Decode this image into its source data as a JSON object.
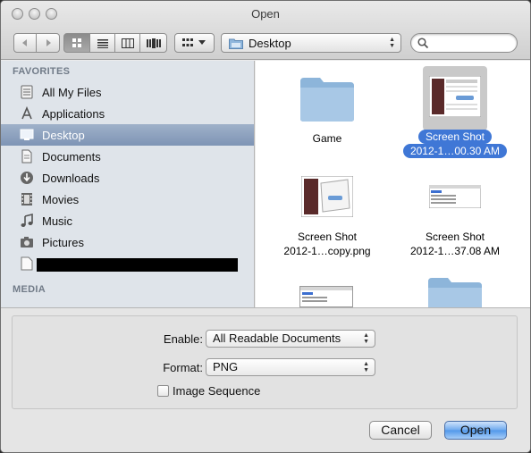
{
  "window": {
    "title": "Open"
  },
  "toolbar": {
    "back_icon": "chevron-left-icon",
    "forward_icon": "chevron-right-icon",
    "view_modes": [
      "icon-view",
      "list-view",
      "column-view",
      "coverflow-view"
    ],
    "arrange_icon": "grid-icon",
    "location": "Desktop",
    "search_placeholder": ""
  },
  "sidebar": {
    "favorites_header": "FAVORITES",
    "items": [
      {
        "label": "All My Files",
        "icon": "all-files-icon"
      },
      {
        "label": "Applications",
        "icon": "applications-icon"
      },
      {
        "label": "Desktop",
        "icon": "desktop-icon",
        "selected": true
      },
      {
        "label": "Documents",
        "icon": "documents-icon"
      },
      {
        "label": "Downloads",
        "icon": "downloads-icon"
      },
      {
        "label": "Movies",
        "icon": "movies-icon"
      },
      {
        "label": "Music",
        "icon": "music-icon"
      },
      {
        "label": "Pictures",
        "icon": "pictures-icon"
      }
    ],
    "media_header": "MEDIA"
  },
  "files": [
    {
      "line1": "Game",
      "line2": "",
      "kind": "folder"
    },
    {
      "line1": "Screen Shot",
      "line2": "2012-1…00.30 AM",
      "kind": "screenshot",
      "selected": true
    },
    {
      "line1": "Screen Shot",
      "line2": "2012-1…copy.png",
      "kind": "screenshot"
    },
    {
      "line1": "Screen Shot",
      "line2": "2012-1…37.08 AM",
      "kind": "screenshot"
    }
  ],
  "options": {
    "enable_label": "Enable:",
    "enable_value": "All Readable Documents",
    "format_label": "Format:",
    "format_value": "PNG",
    "image_sequence_label": "Image Sequence",
    "image_sequence_checked": false
  },
  "buttons": {
    "cancel": "Cancel",
    "open": "Open"
  },
  "colors": {
    "selection": "#3f77d6",
    "sidebar_bg": "#dfe4ea",
    "sidebar_selected": "#8a9fbd"
  }
}
